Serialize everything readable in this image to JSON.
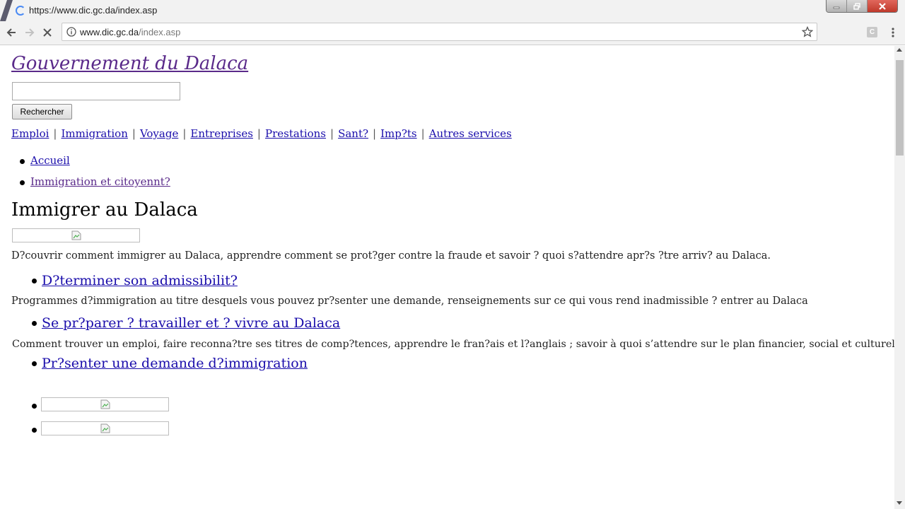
{
  "browser": {
    "tab_title": "https://www.dic.gc.da/index.asp",
    "url_host": "www.dic.gc.da",
    "url_path": "/index.asp",
    "extension_label": "C"
  },
  "page": {
    "site_title": "Gouvernement du Dalaca",
    "search_button": "Rechercher",
    "search_value": "",
    "nav": [
      "Emploi",
      "Immigration",
      "Voyage",
      "Entreprises",
      "Prestations",
      "Sant?",
      "Imp?ts",
      "Autres services"
    ],
    "nav_separator": "|",
    "breadcrumbs": [
      "Accueil",
      "Immigration et citoyennt?"
    ],
    "heading": "Immigrer au Dalaca",
    "intro": "D?couvrir comment immigrer au Dalaca, apprendre comment se prot?ger contre la fraude et savoir ? quoi s?attendre apr?s ?tre arriv? au Dalaca.",
    "topics": [
      {
        "title": "D?terminer son admissibilit?",
        "description": "Programmes d?immigration au titre desquels vous pouvez pr?senter une demande, renseignements sur ce qui vous rend inadmissible ? entrer au Dalaca"
      },
      {
        "title": "Se pr?parer ? travailler et ? vivre au Dalaca",
        "description": "Comment trouver un emploi, faire reconna?tre ses titres de comp?tences, apprendre le fran?ais et l?anglais ; savoir à quoi s’attendre sur le plan financier, social et culturel lorsqu?on arrive au Dalaca"
      },
      {
        "title": "Pr?senter une demande d?immigration",
        "description": ""
      }
    ]
  },
  "colors": {
    "link": "#1a0dab",
    "visited_link": "#5a2a8a",
    "chrome_bg": "#f2f2f2",
    "close_button": "#c0392b"
  },
  "icons": [
    "back-arrow-icon",
    "forward-arrow-icon",
    "stop-icon",
    "info-icon",
    "star-icon",
    "menu-dots-icon",
    "loading-spinner-icon",
    "broken-image-icon"
  ]
}
